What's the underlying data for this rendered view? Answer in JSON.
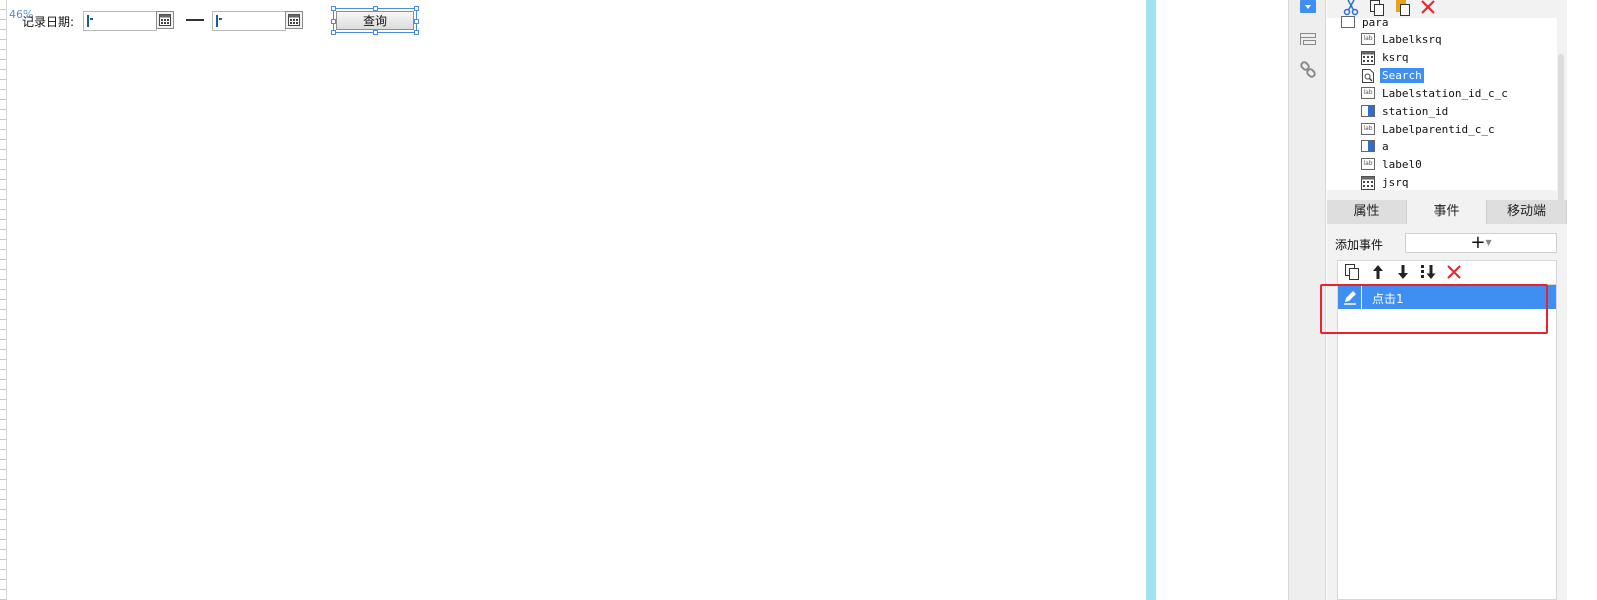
{
  "canvas": {
    "scale_label": "46%",
    "date_label": "记录日期:",
    "query_button": "查询"
  },
  "tree": {
    "root_label": "para",
    "items": [
      {
        "label": "Labelksrq",
        "icon": "label-widget-icon"
      },
      {
        "label": "ksrq",
        "icon": "date-widget-icon"
      },
      {
        "label": "Search",
        "icon": "search-widget-icon",
        "selected": true
      },
      {
        "label": "Labelstation_id_c_c",
        "icon": "label-widget-icon"
      },
      {
        "label": "station_id",
        "icon": "combo-widget-icon"
      },
      {
        "label": "Labelparentid_c_c",
        "icon": "label-widget-icon"
      },
      {
        "label": "a",
        "icon": "combo-widget-icon"
      },
      {
        "label": "label0",
        "icon": "label-widget-icon"
      },
      {
        "label": "jsrq",
        "icon": "date-widget-icon"
      }
    ]
  },
  "tabs": [
    {
      "label": "属性",
      "active": false
    },
    {
      "label": "事件",
      "active": true
    },
    {
      "label": "移动端",
      "active": false
    }
  ],
  "events": {
    "add_label": "添加事件",
    "rows": [
      {
        "label": "点击1",
        "selected": true
      }
    ]
  },
  "colors": {
    "accent": "#3f8ef2",
    "highlight": "#e8232a",
    "gutter": "#9fe3f3"
  }
}
